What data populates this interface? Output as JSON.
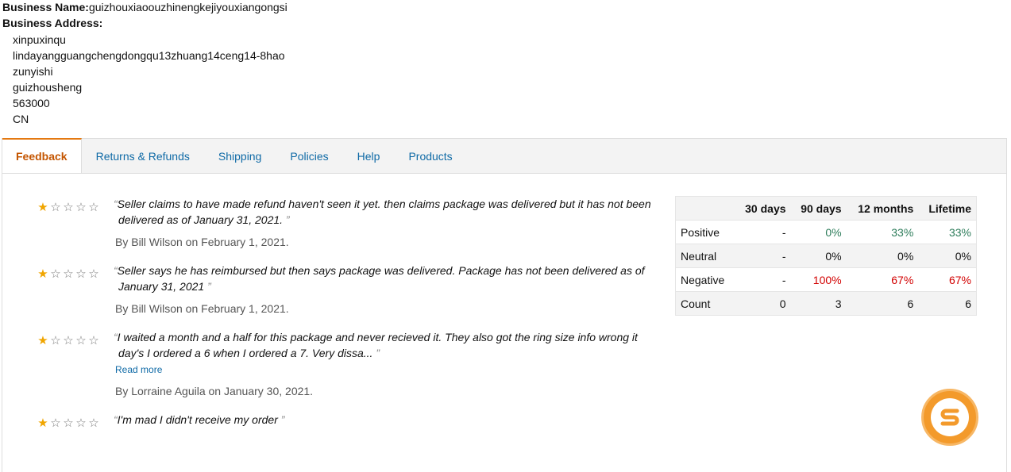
{
  "business": {
    "name_label": "Business Name:",
    "name_value": "guizhouxiaoouzhinengkejiyouxiangongsi",
    "address_label": "Business Address:",
    "address_lines": [
      "xinpuxinqu",
      "lindayangguangchengdongqu13zhuang14ceng14-8hao",
      "zunyishi",
      "guizhousheng",
      "563000",
      "CN"
    ]
  },
  "tabs": [
    {
      "label": "Feedback",
      "active": true
    },
    {
      "label": "Returns & Refunds",
      "active": false
    },
    {
      "label": "Shipping",
      "active": false
    },
    {
      "label": "Policies",
      "active": false
    },
    {
      "label": "Help",
      "active": false
    },
    {
      "label": "Products",
      "active": false
    }
  ],
  "reviews": [
    {
      "rating": 1,
      "text": "Seller claims to have made refund haven't seen it yet. then claims package was delivered but it has not been delivered as of January 31, 2021.",
      "byline": "By Bill Wilson on February 1, 2021."
    },
    {
      "rating": 1,
      "text": "Seller says he has reimbursed but then says package was delivered. Package has not been delivered as of January 31, 2021",
      "byline": "By Bill Wilson on February 1, 2021."
    },
    {
      "rating": 1,
      "text": "I waited a month and a half for this package and never recieved it. They also got the ring size info wrong it day's I ordered a 6 when I ordered a 7. Very dissa...",
      "read_more": "Read more",
      "byline": "By Lorraine Aguila on January 30, 2021."
    },
    {
      "rating": 1,
      "text": "I'm mad I didn't receive my order",
      "byline": ""
    }
  ],
  "stats": {
    "columns": [
      "",
      "30 days",
      "90 days",
      "12 months",
      "Lifetime"
    ],
    "rows": [
      {
        "label": "Positive",
        "values": [
          "-",
          "0%",
          "33%",
          "33%"
        ],
        "tone": "pos"
      },
      {
        "label": "Neutral",
        "values": [
          "-",
          "0%",
          "0%",
          "0%"
        ],
        "tone": ""
      },
      {
        "label": "Negative",
        "values": [
          "-",
          "100%",
          "67%",
          "67%"
        ],
        "tone": "neg"
      },
      {
        "label": "Count",
        "values": [
          "0",
          "3",
          "6",
          "6"
        ],
        "tone": ""
      }
    ]
  },
  "colors": {
    "accent_tab": "#c45500",
    "link": "#0f6aa6",
    "star": "#f0a500",
    "positive": "#2e7d5b",
    "negative": "#d20000",
    "badge": "#f39a2b"
  },
  "icons": {
    "badge": "orange-circle-s-logo"
  }
}
